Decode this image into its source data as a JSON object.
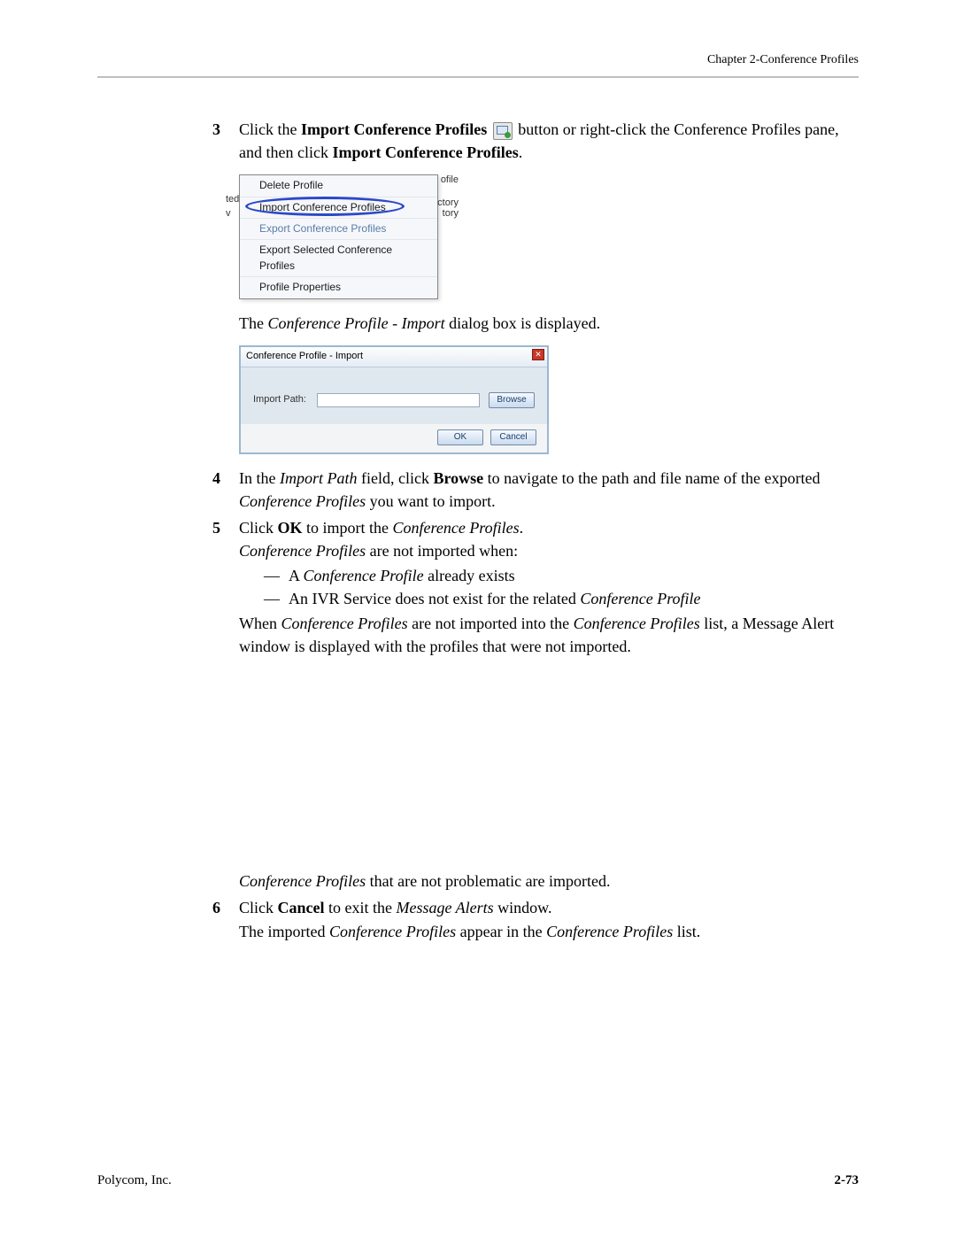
{
  "header": {
    "chapter": "Chapter 2-Conference Profiles"
  },
  "steps": {
    "s3": {
      "num": "3",
      "t1": "Click the ",
      "t2": "Import Conference Profiles",
      "t3": " button or right-click the Conference Profiles pane, and then click ",
      "t4": "Import Conference Profiles",
      "t5": "."
    },
    "menu": {
      "row0": "Delete Profile",
      "row1": "Import Conference Profiles",
      "row2": "Export Conference Profiles",
      "row3": "Export Selected Conference Profiles",
      "row4": "Profile Properties",
      "ext_top": "ofile",
      "ext_r1": "ctory",
      "ext_r2": "tory",
      "left1": "ted",
      "left2": "v"
    },
    "post_menu": {
      "a": "The ",
      "b": "Conference Profile - Import",
      "c": " dialog box is displayed."
    },
    "dialog": {
      "title": "Conference Profile - Import",
      "label": "Import Path:",
      "browse": "Browse",
      "ok": "OK",
      "cancel": "Cancel"
    },
    "s4": {
      "num": "4",
      "a": "In the ",
      "b": "Import Path",
      "c": " field, click ",
      "d": "Browse",
      "e": " to navigate to the path and file name of the exported ",
      "f": "Conference Profiles",
      "g": " you want to import."
    },
    "s5": {
      "num": "5",
      "a": "Click ",
      "b": "OK",
      "c": " to import the ",
      "d": "Conference Profiles",
      "e": ".",
      "line2a": "Conference Profiles",
      "line2b": " are not imported when:",
      "b1a": "A ",
      "b1b": "Conference Profile",
      "b1c": " already exists",
      "b2a": "An IVR Service does not exist for the related ",
      "b2b": "Conference Profile",
      "wa": "When ",
      "wb": "Conference Profiles",
      "wc": " are not imported into the ",
      "wd": "Conference Profiles",
      "we": " list, a Message Alert window is displayed with the profiles that were not imported."
    },
    "s5_after": {
      "a": "Conference Profiles",
      "b": " that are not problematic are imported."
    },
    "s6": {
      "num": "6",
      "a": "Click ",
      "b": "Cancel",
      "c": " to exit the ",
      "d": "Message Alerts",
      "e": " window.",
      "fa": "The imported ",
      "fb": "Conference Profiles",
      "fc": " appear in the ",
      "fd": "Conference Profiles",
      "fe": " list."
    }
  },
  "footer": {
    "company": "Polycom, Inc.",
    "page": "2-73"
  }
}
